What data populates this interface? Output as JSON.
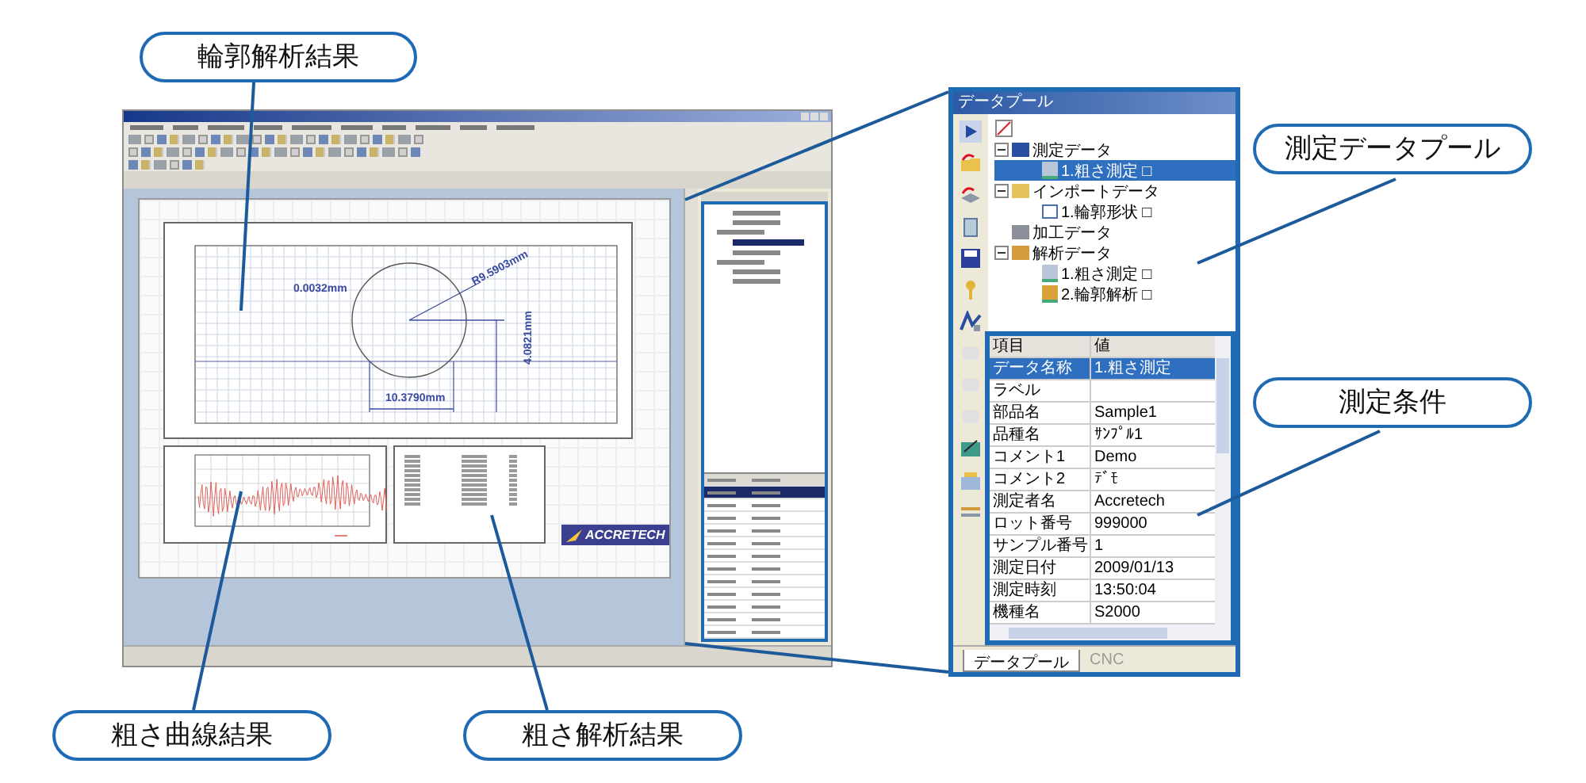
{
  "callouts": {
    "contour_result": "輪郭解析結果",
    "data_pool": "測定データプール",
    "conditions": "測定条件",
    "roughness_curve": "粗さ曲線結果",
    "roughness_analysis": "粗さ解析結果"
  },
  "contour_plot": {
    "annotations": [
      "0.0032mm",
      "R9.5903mm",
      "10.3790mm",
      "4.0821mm"
    ]
  },
  "logo": "ACCRETECH",
  "data_pool": {
    "title": "データプール",
    "tree": [
      {
        "label": "測定データ",
        "kind": "measured",
        "expanded": true,
        "selected": false,
        "children": [
          {
            "label": "1.粗さ測定 □",
            "kind": "roughness",
            "selected": true
          }
        ]
      },
      {
        "label": "インポートデータ",
        "kind": "import",
        "expanded": true,
        "selected": false,
        "children": [
          {
            "label": "1.輪郭形状 □",
            "kind": "contour",
            "selected": false
          }
        ]
      },
      {
        "label": "加工データ",
        "kind": "processed",
        "selected": false
      },
      {
        "label": "解析データ",
        "kind": "analysis",
        "expanded": true,
        "selected": false,
        "children": [
          {
            "label": "1.粗さ測定 □",
            "kind": "roughness",
            "selected": false
          },
          {
            "label": "2.輪郭解析 □",
            "kind": "analysis",
            "selected": false
          }
        ]
      }
    ],
    "table": {
      "columns": [
        "項目",
        "値"
      ],
      "rows": [
        {
          "name": "データ名称",
          "value": "1.粗さ測定",
          "selected": true
        },
        {
          "name": "ラベル",
          "selected": false
        },
        {
          "name": "部品名",
          "value": "Sample1",
          "selected": false
        },
        {
          "name": "品種名",
          "value": "ｻﾝﾌﾟﾙ1",
          "selected": false
        },
        {
          "name": "コメント1",
          "value": "Demo",
          "selected": false
        },
        {
          "name": "コメント2",
          "value": "ﾃﾞﾓ",
          "selected": false
        },
        {
          "name": "測定者名",
          "value": "Accretech",
          "selected": false
        },
        {
          "name": "ロット番号",
          "value": "999000",
          "selected": false
        },
        {
          "name": "サンプル番号",
          "value": "1",
          "selected": false
        },
        {
          "name": "測定日付",
          "value": "2009/01/13",
          "selected": false
        },
        {
          "name": "測定時刻",
          "value": "13:50:04",
          "selected": false
        },
        {
          "name": "機種名",
          "value": "S2000",
          "selected": false
        }
      ]
    },
    "tabs": [
      {
        "label": "データプール",
        "selected": true
      },
      {
        "label": "CNC",
        "selected": false
      }
    ]
  }
}
